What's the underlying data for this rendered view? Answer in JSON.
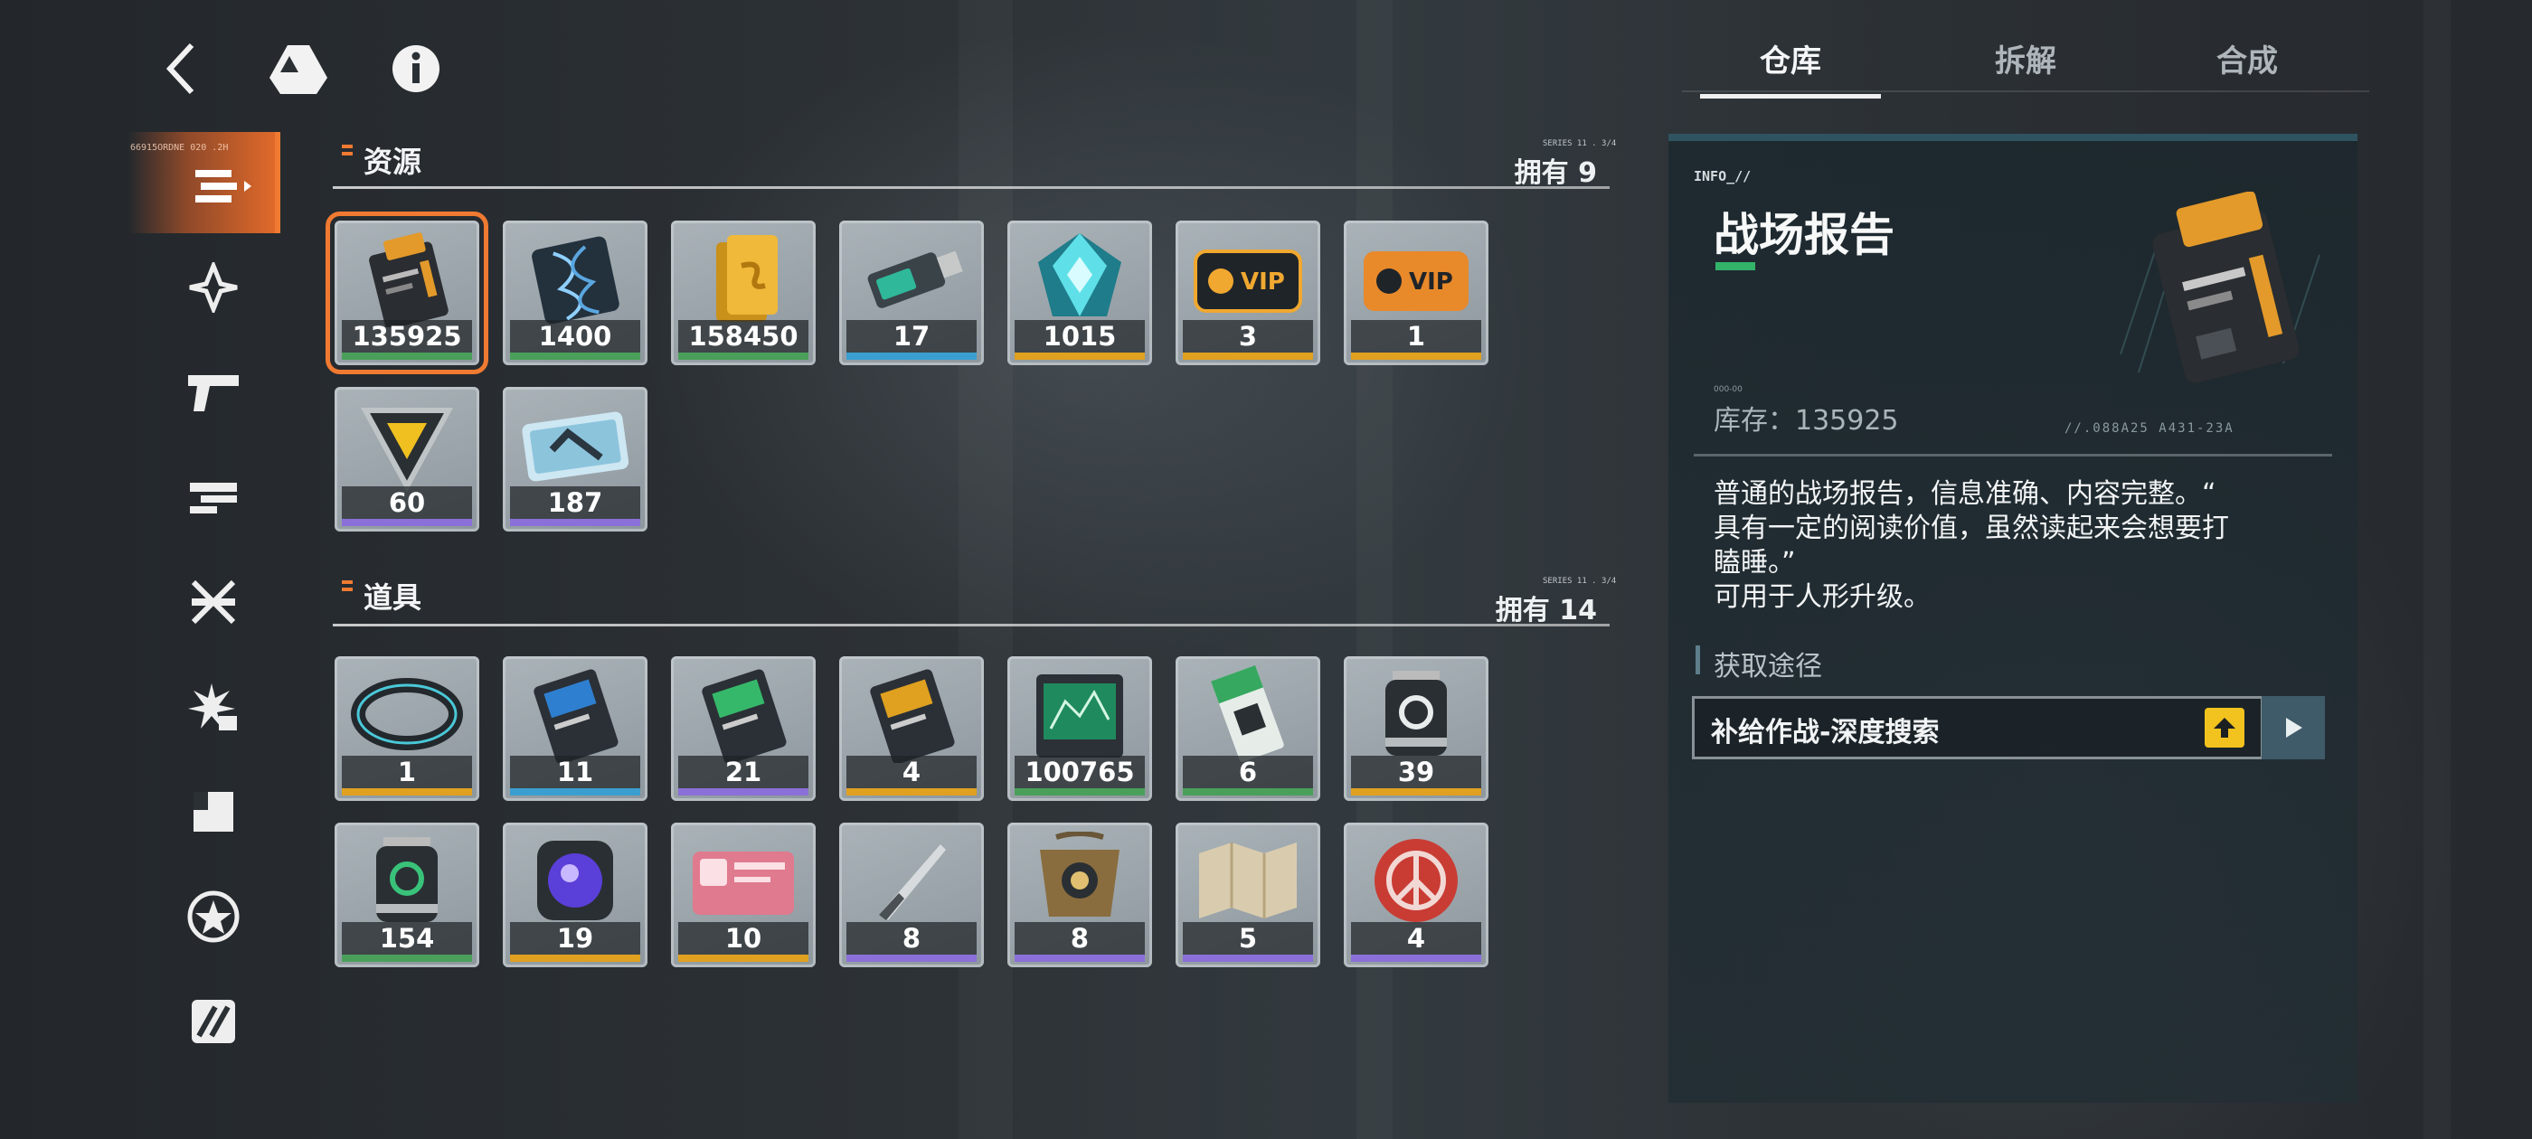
{
  "tabs": [
    "仓库",
    "拆解",
    "合成"
  ],
  "sidebar": {
    "active_tag": "66915ORDNE 020 .2H",
    "items": [
      "resources-icon",
      "blade-icon",
      "pistol-icon",
      "rifle-icon",
      "scissors-icon",
      "plant-lock-icon",
      "box-icon",
      "star-badge-icon",
      "slash-card-icon"
    ]
  },
  "resources": {
    "title": "资源",
    "owned": "拥有 9",
    "items": [
      {
        "qty": "135925",
        "rarity": "green",
        "icon": "battle-report-icon"
      },
      {
        "qty": "1400",
        "rarity": "green",
        "icon": "dna-card-icon"
      },
      {
        "qty": "158450",
        "rarity": "green",
        "icon": "gold-bar-icon"
      },
      {
        "qty": "17",
        "rarity": "blue",
        "icon": "usb-key-icon"
      },
      {
        "qty": "1015",
        "rarity": "gold",
        "icon": "crystal-icon"
      },
      {
        "qty": "3",
        "rarity": "gold",
        "icon": "vip-card-icon"
      },
      {
        "qty": "1",
        "rarity": "gold",
        "icon": "vip-card-orange-icon"
      },
      {
        "qty": "60",
        "rarity": "purple",
        "icon": "triangle-chip-icon"
      },
      {
        "qty": "187",
        "rarity": "purple",
        "icon": "holo-ticket-icon"
      }
    ]
  },
  "props": {
    "title": "道具",
    "owned": "拥有 14",
    "items": [
      {
        "qty": "1",
        "rarity": "gold",
        "icon": "bracelet-icon"
      },
      {
        "qty": "11",
        "rarity": "blue",
        "icon": "blue-card-icon"
      },
      {
        "qty": "21",
        "rarity": "purple",
        "icon": "green-card-icon"
      },
      {
        "qty": "4",
        "rarity": "gold",
        "icon": "gold-card-icon"
      },
      {
        "qty": "100765",
        "rarity": "green",
        "icon": "blueprint-icon"
      },
      {
        "qty": "6",
        "rarity": "green",
        "icon": "ticket-icon"
      },
      {
        "qty": "39",
        "rarity": "gold",
        "icon": "canister-dark-icon"
      },
      {
        "qty": "154",
        "rarity": "green",
        "icon": "canister-green-icon"
      },
      {
        "qty": "19",
        "rarity": "gold",
        "icon": "core-orb-icon"
      },
      {
        "qty": "10",
        "rarity": "gold",
        "icon": "pink-card-icon"
      },
      {
        "qty": "8",
        "rarity": "purple",
        "icon": "knife-icon"
      },
      {
        "qty": "8",
        "rarity": "purple",
        "icon": "bag-icon"
      },
      {
        "qty": "5",
        "rarity": "purple",
        "icon": "map-icon"
      },
      {
        "qty": "4",
        "rarity": "purple",
        "icon": "peace-badge-icon"
      }
    ]
  },
  "detail": {
    "tag": "INFO_//",
    "name": "战场报告",
    "stock_label": "库存：135925",
    "stock_code": "000-00",
    "art_code": "//.088A25    A431-23A",
    "description": [
      "普通的战场报告，信息准确、内容完整。“",
      "具有一定的阅读价值，虽然读起来会想要打",
      "瞌睡。”",
      "可用于人形升级。"
    ],
    "source_title": "获取途径",
    "source_label": "补给作战-深度搜索"
  },
  "colors": {
    "accent": "#f07a32",
    "green": "#4aa05a",
    "blue": "#3a9fd0",
    "gold": "#e0a020",
    "purple": "#8a70d8",
    "badge": "#f2c21e"
  }
}
